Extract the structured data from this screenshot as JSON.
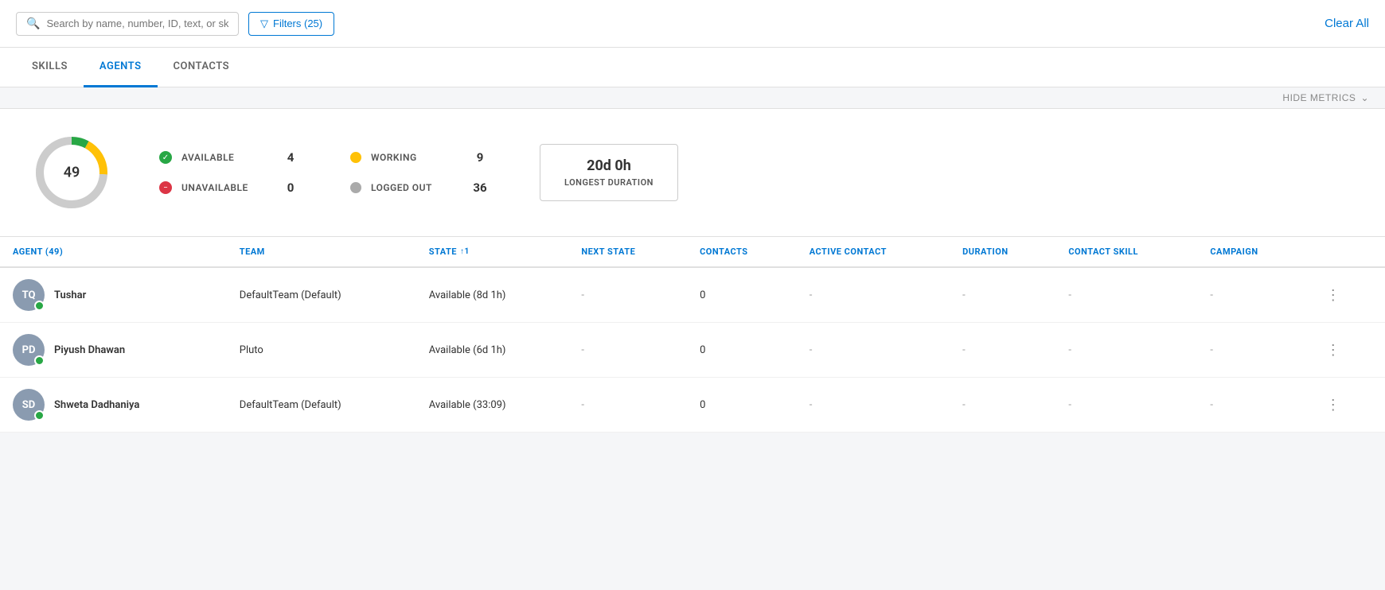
{
  "topbar": {
    "search_placeholder": "Search by name, number, ID, text, or skill",
    "filter_label": "Filters (25)",
    "clear_all_label": "Clear All"
  },
  "tabs": [
    {
      "id": "skills",
      "label": "SKILLS",
      "active": false
    },
    {
      "id": "agents",
      "label": "AGENTS",
      "active": true
    },
    {
      "id": "contacts",
      "label": "CONTACTS",
      "active": false
    }
  ],
  "metrics_toggle": "HIDE METRICS",
  "metrics": {
    "donut": {
      "total": 49,
      "available_pct": 8,
      "working_pct": 18,
      "logged_out_pct": 74
    },
    "stats": [
      {
        "id": "available",
        "label": "AVAILABLE",
        "value": "4",
        "type": "available"
      },
      {
        "id": "unavailable",
        "label": "UNAVAILABLE",
        "value": "0",
        "type": "unavailable"
      },
      {
        "id": "working",
        "label": "WORKING",
        "value": "9",
        "type": "working"
      },
      {
        "id": "logged_out",
        "label": "LOGGED OUT",
        "value": "36",
        "type": "logged-out"
      }
    ],
    "duration": {
      "value": "20d 0h",
      "label": "LONGEST DURATION"
    }
  },
  "table": {
    "columns": [
      {
        "id": "agent",
        "label": "AGENT (49)",
        "sortable": false
      },
      {
        "id": "team",
        "label": "TEAM",
        "sortable": false
      },
      {
        "id": "state",
        "label": "STATE",
        "sortable": true,
        "sort_indicator": "↑1"
      },
      {
        "id": "next_state",
        "label": "NEXT STATE",
        "sortable": false
      },
      {
        "id": "contacts",
        "label": "CONTACTS",
        "sortable": false
      },
      {
        "id": "active_contact",
        "label": "ACTIVE CONTACT",
        "sortable": false
      },
      {
        "id": "duration",
        "label": "DURATION",
        "sortable": false
      },
      {
        "id": "contact_skill",
        "label": "CONTACT SKILL",
        "sortable": false
      },
      {
        "id": "campaign",
        "label": "CAMPAIGN",
        "sortable": false
      }
    ],
    "rows": [
      {
        "id": "tushar",
        "initials": "TQ",
        "name": "Tushar",
        "team": "DefaultTeam (Default)",
        "state": "Available (8d 1h)",
        "next_state": "-",
        "contacts": "0",
        "active_contact": "-",
        "duration": "-",
        "contact_skill": "-",
        "campaign": "-",
        "status": "available"
      },
      {
        "id": "piyush",
        "initials": "PD",
        "name": "Piyush Dhawan",
        "team": "Pluto",
        "state": "Available (6d 1h)",
        "next_state": "-",
        "contacts": "0",
        "active_contact": "-",
        "duration": "-",
        "contact_skill": "-",
        "campaign": "-",
        "status": "available"
      },
      {
        "id": "shweta",
        "initials": "SD",
        "name": "Shweta Dadhaniya",
        "team": "DefaultTeam (Default)",
        "state": "Available (33:09)",
        "next_state": "-",
        "contacts": "0",
        "active_contact": "-",
        "duration": "-",
        "contact_skill": "-",
        "campaign": "-",
        "status": "available"
      }
    ]
  }
}
